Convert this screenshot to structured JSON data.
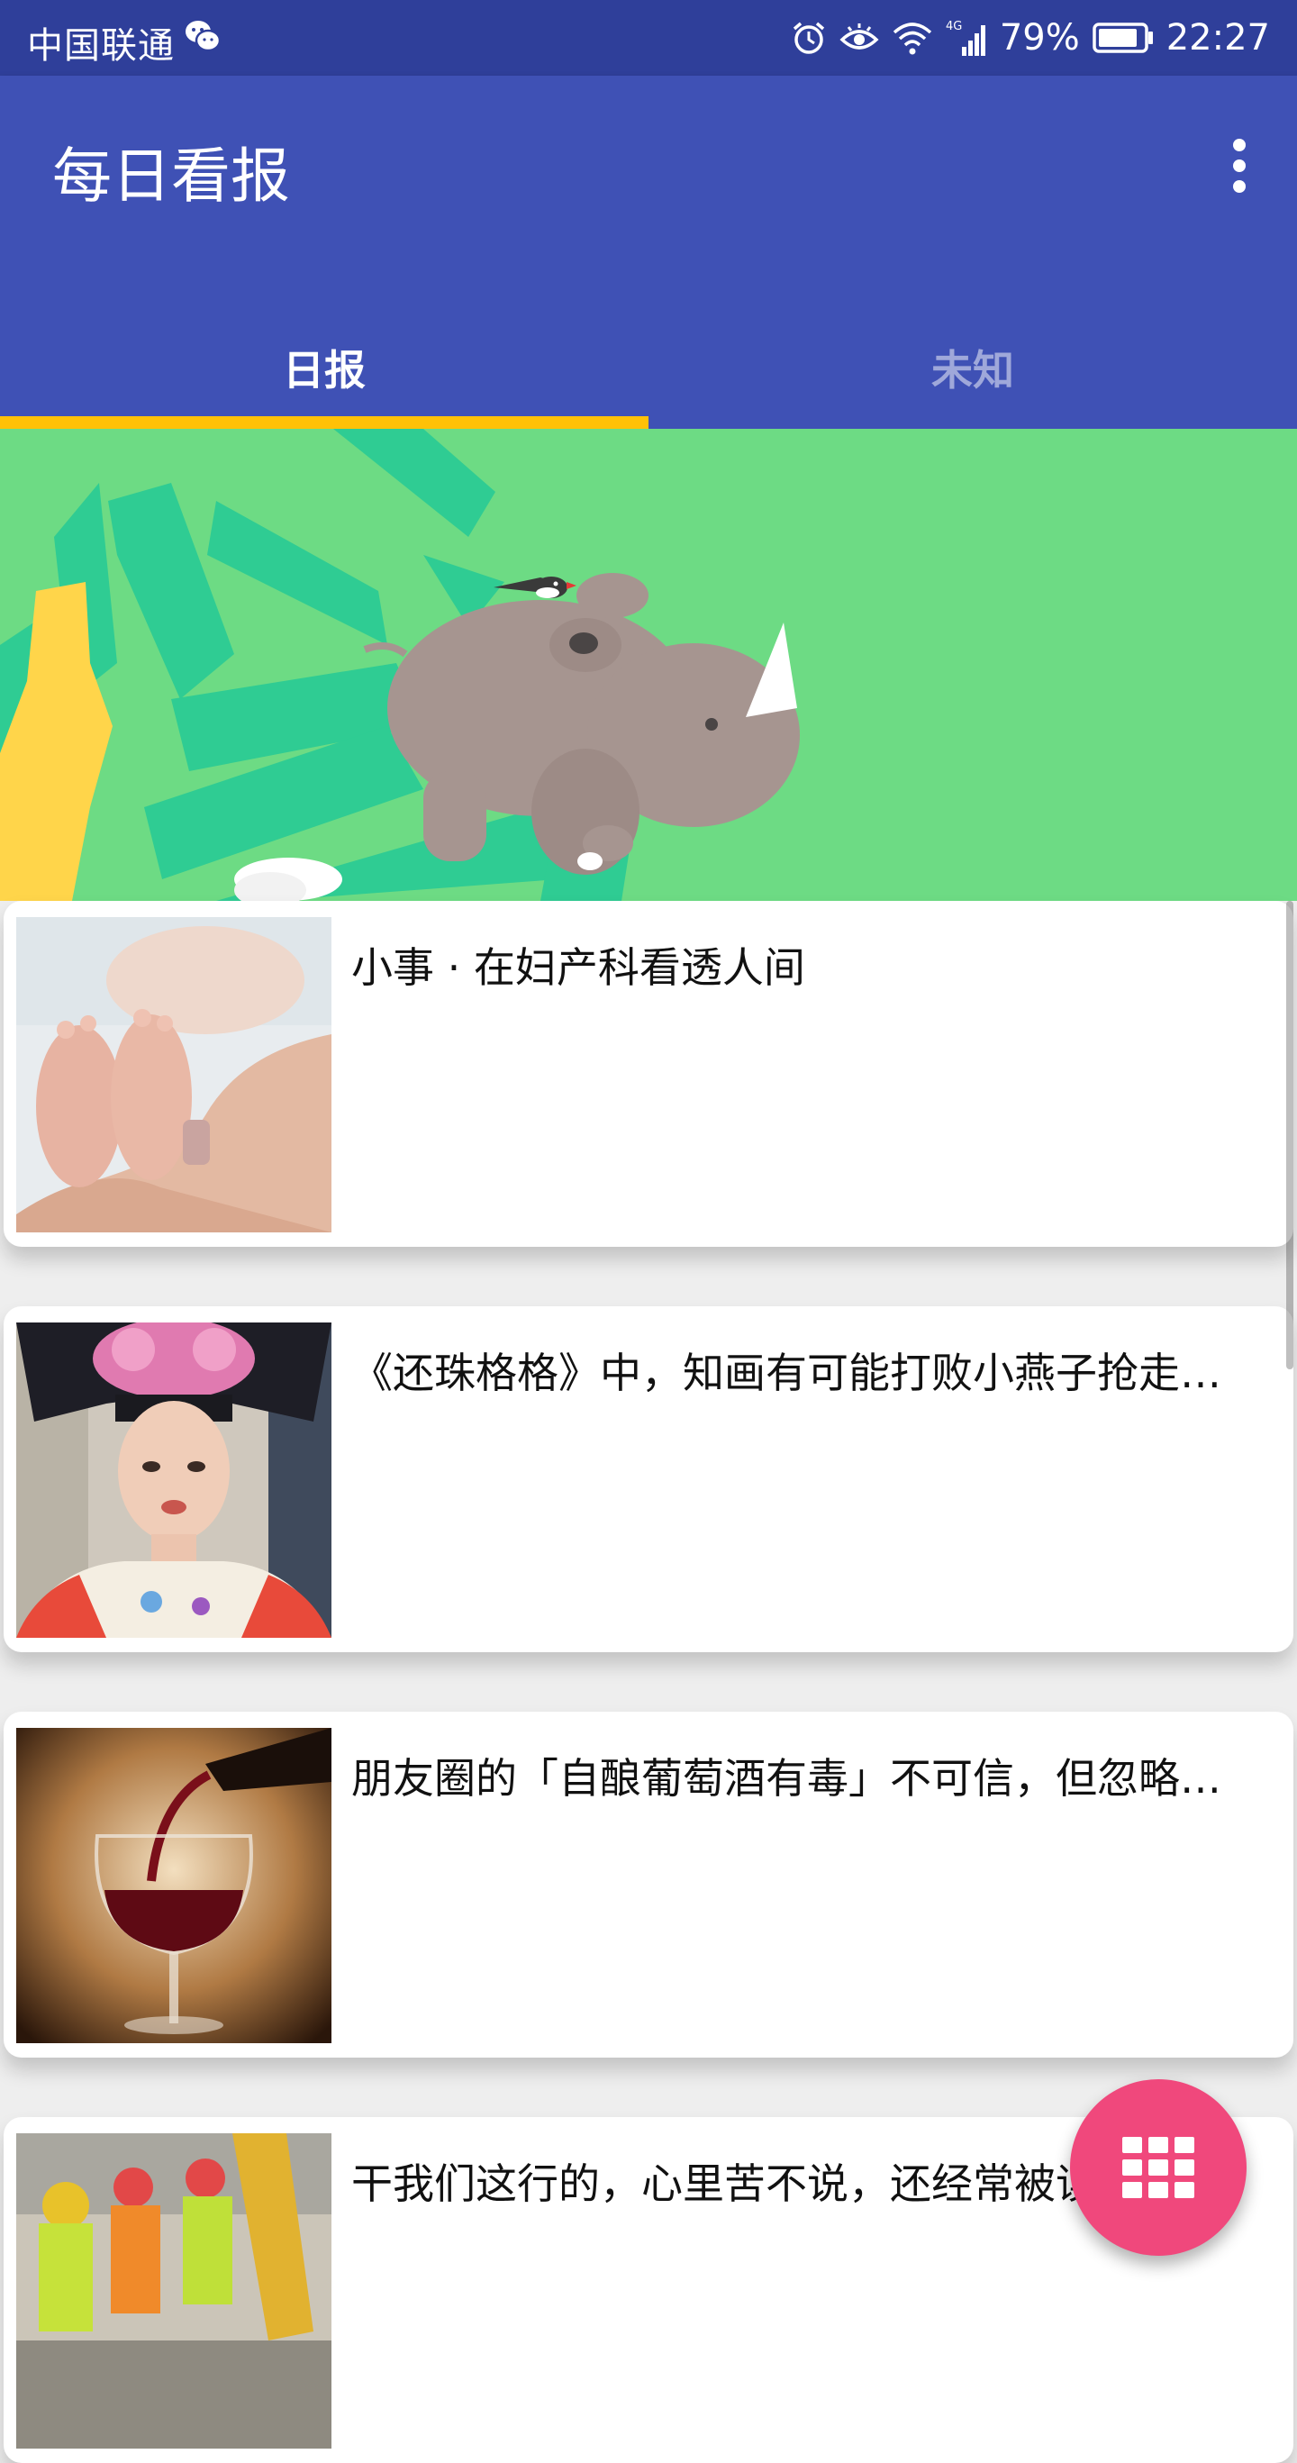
{
  "status_bar": {
    "carrier": "中国联通",
    "battery": "79%",
    "time": "22:27",
    "network": "4G",
    "icons": [
      "wechat-icon",
      "alarm-icon",
      "eye-icon",
      "wifi-icon",
      "signal-icon",
      "battery-icon"
    ]
  },
  "app_bar": {
    "title": "每日看报",
    "menu_icon": "more-vertical-icon",
    "color": "#3f51b5"
  },
  "tabs": [
    {
      "label": "日报",
      "active": true
    },
    {
      "label": "未知",
      "active": false
    }
  ],
  "tab_indicator_color": "#ffc107",
  "banner": {
    "image": "rhino-illustration"
  },
  "articles": [
    {
      "title": "小事 · 在妇产科看透人间",
      "thumbnail": "newborn-feet-photo"
    },
    {
      "title": "《还珠格格》中，知画有可能打败小燕子抢走五阿哥吗？",
      "thumbnail": "qing-costume-actress-photo"
    },
    {
      "title": "朋友圈的「自酿葡萄酒有毒」不可信，但忽略风险也不行",
      "thumbnail": "red-wine-glass-photo"
    },
    {
      "title": "干我们这行的，心里苦不说，还经常被误解",
      "thumbnail": "construction-workers-photo"
    }
  ],
  "fab": {
    "icon": "grid-apps-icon",
    "color": "#f0487c"
  }
}
